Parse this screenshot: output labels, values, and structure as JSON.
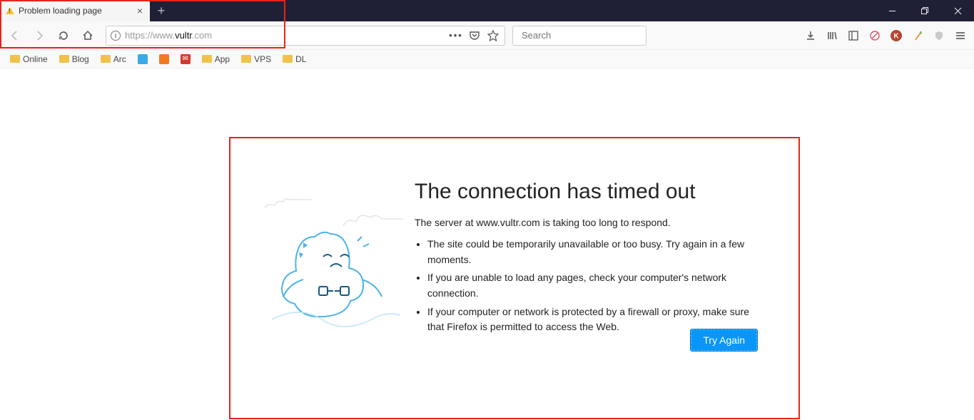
{
  "tab": {
    "title": "Problem loading page"
  },
  "url": {
    "prefix": "https://www.",
    "domain": "vultr",
    "suffix": ".com"
  },
  "search": {
    "placeholder": "Search"
  },
  "bookmarks": [
    {
      "label": "Online",
      "icon": "folder"
    },
    {
      "label": "Blog",
      "icon": "folder"
    },
    {
      "label": "Arc",
      "icon": "folder"
    },
    {
      "label": "",
      "icon": "blue"
    },
    {
      "label": "",
      "icon": "orange"
    },
    {
      "label": "",
      "icon": "red"
    },
    {
      "label": "App",
      "icon": "folder"
    },
    {
      "label": "VPS",
      "icon": "folder"
    },
    {
      "label": "DL",
      "icon": "folder"
    }
  ],
  "error": {
    "title": "The connection has timed out",
    "subtitle": "The server at www.vultr.com is taking too long to respond.",
    "items": [
      "The site could be temporarily unavailable or too busy. Try again in a few moments.",
      "If you are unable to load any pages, check your computer's network connection.",
      "If your computer or network is protected by a firewall or proxy, make sure that Firefox is permitted to access the Web."
    ],
    "button": "Try Again"
  }
}
